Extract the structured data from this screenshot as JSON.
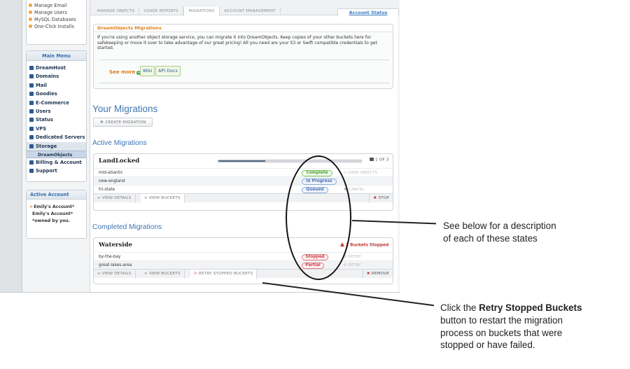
{
  "sidebar": {
    "account_links": [
      "Manage Email",
      "Manage Users",
      "MySQL Databases",
      "One-Click Installs"
    ],
    "main_menu_title": "Main Menu",
    "menu_items": [
      "DreamHost",
      "Domains",
      "Mail",
      "Goodies",
      "E-Commerce",
      "Users",
      "Status",
      "VPS",
      "Dedicated Servers",
      "Storage"
    ],
    "submenu_item": "DreamObjects",
    "menu_items_after": [
      "Billing & Account",
      "Support"
    ],
    "active_account": {
      "title": "Active Account",
      "current": "Emily's Account*",
      "line2": "Emily's Account*",
      "note": "*owned by you."
    }
  },
  "tabs": [
    "MANAGE OBJECTS",
    "USAGE REPORTS",
    "MIGRATIONS",
    "ACCOUNT MANAGEMENT"
  ],
  "account_status_link": "Account Status",
  "promo": {
    "title": "DreamObjects Migrations",
    "text": "If you're using another object storage service, you can migrate it into DreamObjects. Keep copies of your other buckets here for safekeeping or move it over to take advantage of our great pricing! All you need are your S3 or Swift compatible credentials to get started.",
    "see_more": "See more",
    "links": [
      "Wiki",
      "API Docs"
    ]
  },
  "your_migrations_heading": "Your Migrations",
  "create_migration_label": "CREATE MIGRATION",
  "active_heading": "Active Migrations",
  "active_migration": {
    "name": "LandLocked",
    "progress_fraction": 0.33,
    "progress_text": "1 OF 3",
    "rows": [
      {
        "bucket": "mid-atlantic",
        "status": "Complete",
        "action": "VIEW OBJECTS"
      },
      {
        "bucket": "new-england",
        "status": "In Progress",
        "action": ""
      },
      {
        "bucket": "tri-state",
        "status": "Queued",
        "action": "CANCEL"
      }
    ],
    "footer": {
      "view_details": "VIEW DETAILS",
      "view_buckets": "VIEW BUCKETS",
      "stop": "STOP"
    }
  },
  "completed_heading": "Completed Migrations",
  "completed_migration": {
    "name": "Waterside",
    "stopped_note": "2 Buckets Stopped",
    "rows": [
      {
        "bucket": "by-the-bay",
        "status": "Stopped",
        "action": "RETRY"
      },
      {
        "bucket": "great-lakes-area",
        "status": "Partial",
        "action": "RETRY"
      }
    ],
    "footer": {
      "view_details": "VIEW DETAILS",
      "view_buckets": "VIEW BUCKETS",
      "retry_stopped": "RETRY STOPPED BUCKETS",
      "remove": "REMOVE"
    }
  },
  "annotations": {
    "states_note": [
      "See below for a description",
      "of each of these states"
    ],
    "retry_note": {
      "line1_prefix": "Click the ",
      "line1_bold": "Retry Stopped Buckets",
      "lines": [
        "button to restart the migration",
        "process on buckets that were",
        "stopped or have failed."
      ]
    }
  },
  "colors": {
    "accent_blue": "#3e74b4",
    "accent_orange": "#e07a1a",
    "status_green": "#4aa135",
    "status_red": "#cd4048"
  }
}
